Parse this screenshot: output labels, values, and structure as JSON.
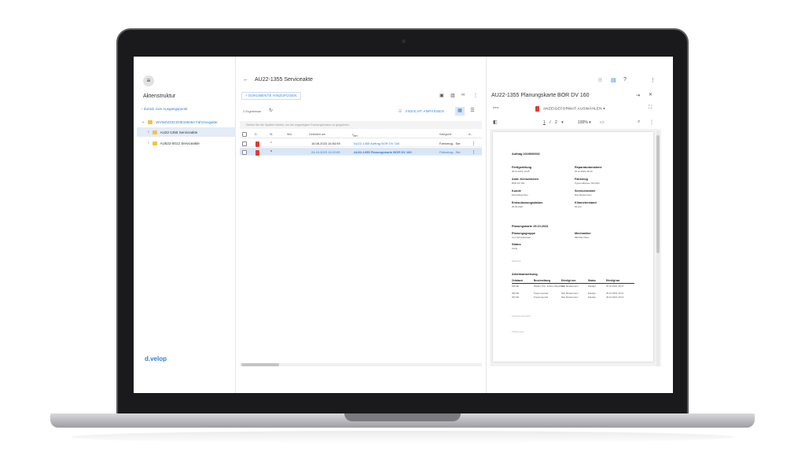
{
  "sidebar": {
    "title": "Aktenstruktur",
    "back_link": "Zurück zum Ausgangspunkt",
    "tree": [
      {
        "label": "WVWZZZ3CZHE158464 Fahrzeugakte",
        "color": "#2f7ed8"
      },
      {
        "label": "AU22-1355 Serviceakte"
      },
      {
        "label": "AU522-0012 Serviceakte"
      }
    ],
    "brand": "d.velop"
  },
  "main": {
    "title": "AU22-1355 Serviceakte",
    "add_button": "+ DOKUMENTE HINZUFÜGEN",
    "results": "2 Ergebnisse",
    "adjust_view": "ANSICHT ANPASSEN",
    "group_hint": "Ziehen Sie die Spalten hierhin, um die angezeigten Suchergebnisse zu gruppieren.",
    "columns": [
      "D.",
      "St.",
      "Wvl.",
      "Geändert am",
      "Titel",
      "Kategorie",
      "A..."
    ],
    "rows": [
      {
        "date": "16.08.2023 16:54:59",
        "title": "AU22-1355 Auftrag BOR DV 160",
        "category": "Fahrzeug - Ser"
      },
      {
        "date": "24.10.2023 11:02:09",
        "title": "AU22-1355 Planungskarte BOR DV 160",
        "category": "Fahrzeug - Ser"
      }
    ]
  },
  "viewer": {
    "title": "AU22-1355 Planungskarte BOR DV 160",
    "format_button": "ANZEIGEFORMAT AUSWÄHLEN",
    "page_current": "1",
    "page_sep": "/",
    "page_total": "2",
    "zoom": "100%",
    "document": {
      "heading": "Auftrag 2019000002",
      "fields": [
        {
          "label": "Fertigstellung",
          "value": "25.10.2023, 10:25"
        },
        {
          "label": "Reparaturannahme",
          "value": "25.10.2023, 08:10"
        },
        {
          "label": "Amtl. Kennzeichen",
          "value": "BOR DV 160"
        },
        {
          "label": "Fahrzeug",
          "value": "Tiguan Allspace TDI DSG"
        },
        {
          "label": "Kunde",
          "value": "Erica Musterfrau"
        },
        {
          "label": "Serviceberater",
          "value": "Max Mustermann"
        },
        {
          "label": "Erstzulassungsdatum",
          "value": "25.06.2020"
        },
        {
          "label": "Kilometerstand",
          "value": "63.123"
        }
      ],
      "planning_heading": "Planungskarte 25.10.2023",
      "group_label": "Planungsgruppe",
      "group_value": "Inon Serviceberater",
      "mechanic_label": "Mechaniker",
      "mechanic_value": "999 Max Meier",
      "status_label": "Status",
      "status_value": "Fertig",
      "diagnosis": "Diagnose",
      "work_heading": "Arbeitsanweisung",
      "work_columns": [
        "Zeitdauer",
        "Beschreibung",
        "Erledigt von",
        "Status",
        "Erledigt am"
      ],
      "work_rows": [
        [
          "180 ZE",
          "Weltan (T3) - Erstes Ölwechsel",
          "Max Mustermann",
          "Erledigt",
          "25.10.2023, 09:27"
        ],
        [
          "250 ZE",
          "Tiguan spezial",
          "Max Mustermann",
          "Erledigt",
          "25.10.2023, 09:27"
        ],
        [
          "250 ZE",
          "Tiguan spezial",
          "Max Mustermann",
          "Erledigt",
          "25.10.2023, 09:27"
        ]
      ],
      "signature1": "Kundenunterschrift",
      "signature2": "Prüfvermerk"
    }
  }
}
